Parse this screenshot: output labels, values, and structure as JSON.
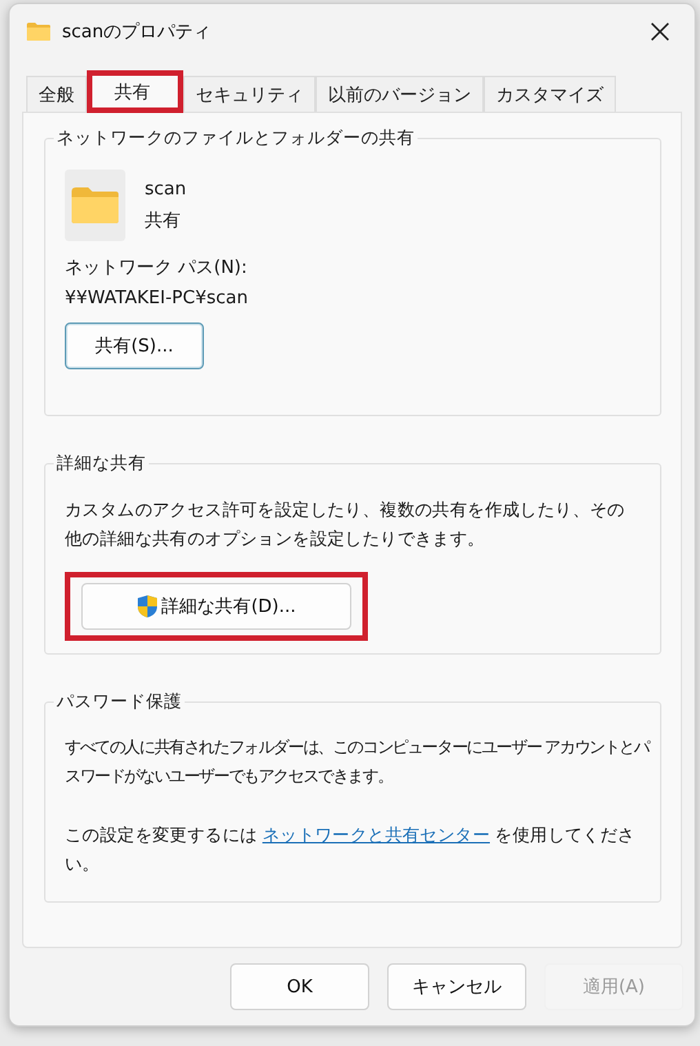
{
  "window": {
    "title": "scanのプロパティ"
  },
  "tabs": [
    {
      "label": "全般",
      "selected": false,
      "highlighted": false
    },
    {
      "label": "共有",
      "selected": true,
      "highlighted": true
    },
    {
      "label": "セキュリティ",
      "selected": false,
      "highlighted": false
    },
    {
      "label": "以前のバージョン",
      "selected": false,
      "highlighted": false
    },
    {
      "label": "カスタマイズ",
      "selected": false,
      "highlighted": false
    }
  ],
  "network_sharing": {
    "title": "ネットワークのファイルとフォルダーの共有",
    "folder_name": "scan",
    "status": "共有",
    "path_label": "ネットワーク パス(N):",
    "path": "¥¥WATAKEI-PC¥scan",
    "share_button": "共有(S)..."
  },
  "advanced_sharing": {
    "title": "詳細な共有",
    "description": "カスタムのアクセス許可を設定したり、複数の共有を作成したり、その他の詳細な共有のオプションを設定したりできます。",
    "button": {
      "label": "詳細な共有(D)...",
      "highlighted": true
    }
  },
  "password_protection": {
    "title": "パスワード保護",
    "description": "すべての人に共有されたフォルダーは、このコンピューターにユーザー アカウントとパスワードがないユーザーでもアクセスできます。",
    "link_prefix": "この設定を変更するには",
    "link": "ネットワークと共有センター",
    "link_suffix": "を使用してください。"
  },
  "buttons": [
    {
      "label": "OK",
      "disabled": false
    },
    {
      "label": "キャンセル",
      "disabled": false
    },
    {
      "label": "適用(A)",
      "disabled": true
    }
  ]
}
